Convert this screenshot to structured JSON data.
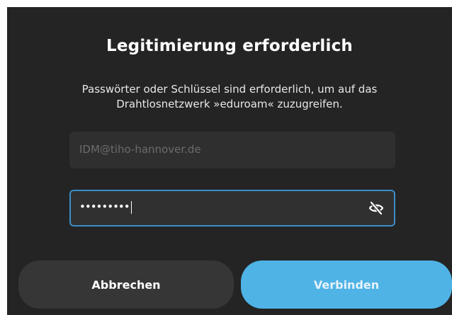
{
  "dialog": {
    "title": "Legitimierung erforderlich",
    "message_line1": "Passwörter oder Schlüssel sind erforderlich, um auf das",
    "message_line2": "Drahtlosnetzwerk »eduroam« zuzugreifen.",
    "username": {
      "placeholder": "IDM@tiho-hannover.de"
    },
    "password": {
      "masked_value": "•••••••••",
      "reveal_icon": "eye-slash-icon"
    },
    "buttons": {
      "cancel_label": "Abbrechen",
      "connect_label": "Verbinden"
    },
    "colors": {
      "background": "#242424",
      "accent": "#4fb3e6",
      "focus_border": "#3a8ec8"
    }
  }
}
